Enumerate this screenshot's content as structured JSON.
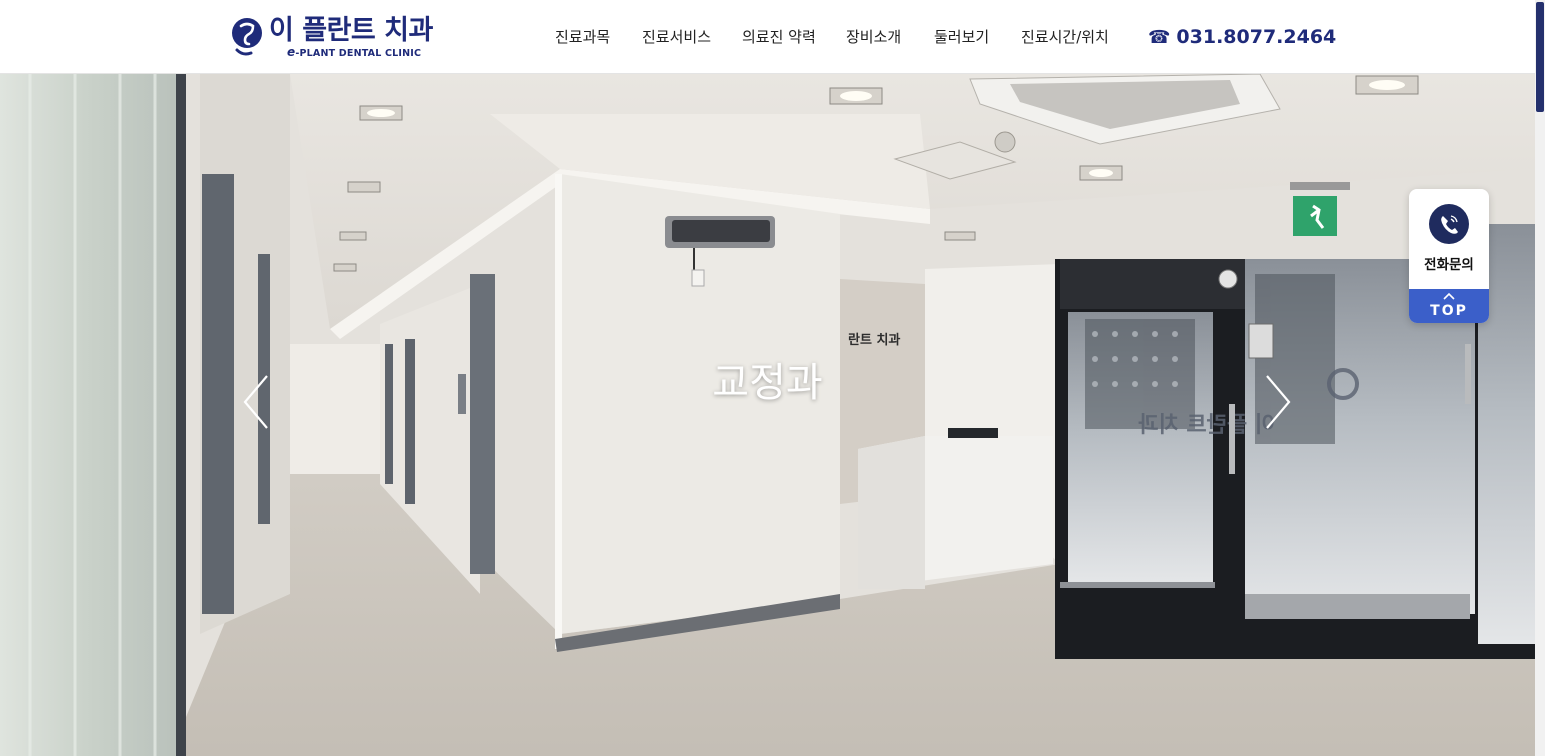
{
  "header": {
    "logo": {
      "name_ko": "이 플란트 치과",
      "name_en_prefix": "e",
      "name_en": "-PLANT DENTAL CLINIC"
    },
    "nav": [
      {
        "label": "진료과목"
      },
      {
        "label": "진료서비스"
      },
      {
        "label": "의료진 약력"
      },
      {
        "label": "장비소개"
      },
      {
        "label": "둘러보기"
      },
      {
        "label": "진료시간/위치"
      }
    ],
    "phone": {
      "icon": "☎",
      "number": "031.8077.2464"
    }
  },
  "hero": {
    "title": "교정과",
    "wall_sign": "란트 치과",
    "door_sign": "이 플란트 치과",
    "prev_icon": "chevron-left-icon",
    "next_icon": "chevron-right-icon"
  },
  "widget": {
    "call_label": "전화문의",
    "call_icon": "phone-icon",
    "top_label": "TOP"
  },
  "colors": {
    "brand_navy": "#1f2b7a",
    "widget_call": "#1f2b5e",
    "widget_top": "#3b5fc9",
    "scroll_thumb": "#24306d"
  }
}
